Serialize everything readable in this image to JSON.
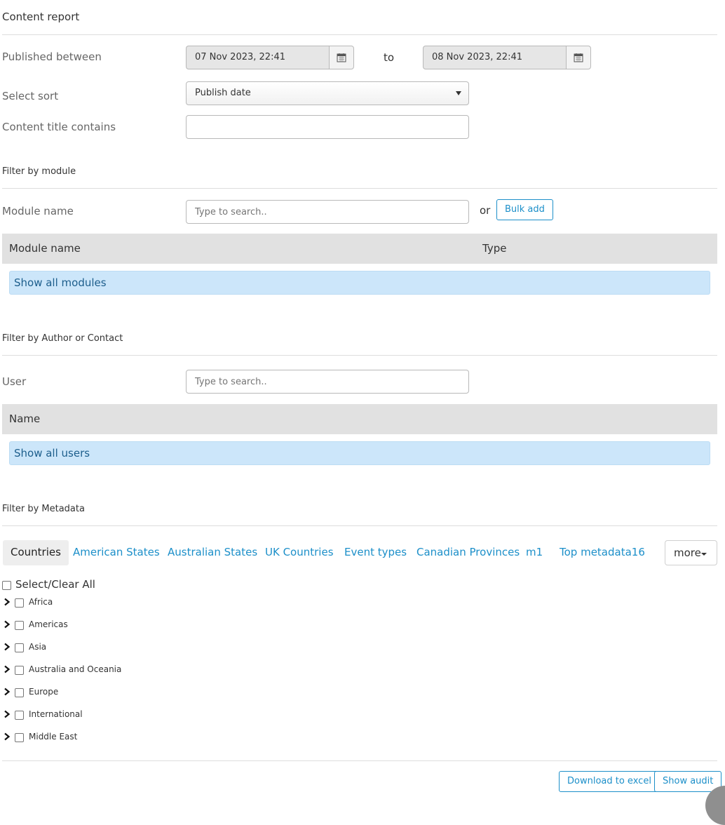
{
  "page": {
    "title": "Content report"
  },
  "published": {
    "label": "Published between",
    "from_value": "07 Nov 2023, 22:41",
    "to_label": "to",
    "to_value": "08 Nov 2023, 22:41"
  },
  "sort": {
    "label": "Select sort",
    "value": "Publish date"
  },
  "title_filter": {
    "label": "Content title contains",
    "value": ""
  },
  "module_filter": {
    "section_title": "Filter by module",
    "label": "Module name",
    "placeholder": "Type to search..",
    "or_text": "or",
    "bulk_add_label": "Bulk add",
    "columns": [
      "Module name",
      "Type"
    ],
    "show_all_label": "Show all modules"
  },
  "author_filter": {
    "section_title": "Filter by Author or Contact",
    "label": "User",
    "placeholder": "Type to search..",
    "columns": [
      "Name"
    ],
    "show_all_label": "Show all users"
  },
  "metadata_filter": {
    "section_title": "Filter by Metadata",
    "tabs": [
      "Countries",
      "American States",
      "Australian States",
      "UK Countries",
      "Event types",
      "Canadian Provinces",
      "m1",
      "Top metadata16"
    ],
    "active_tab": "Countries",
    "more_label": "more",
    "select_all_label": "Select/Clear All",
    "items": [
      "Africa",
      "Americas",
      "Asia",
      "Australia and Oceania",
      "Europe",
      "International",
      "Middle East"
    ]
  },
  "actions": {
    "download_label": "Download to excel",
    "audit_label": "Show audit"
  },
  "colors": {
    "link": "#1c8fc9",
    "info_bg": "#cce6fa",
    "header_bg": "#e1e1e1"
  },
  "icons": {
    "calendar": "calendar-icon",
    "chevron": "chevron-right-icon",
    "caret": "caret-down-icon"
  }
}
